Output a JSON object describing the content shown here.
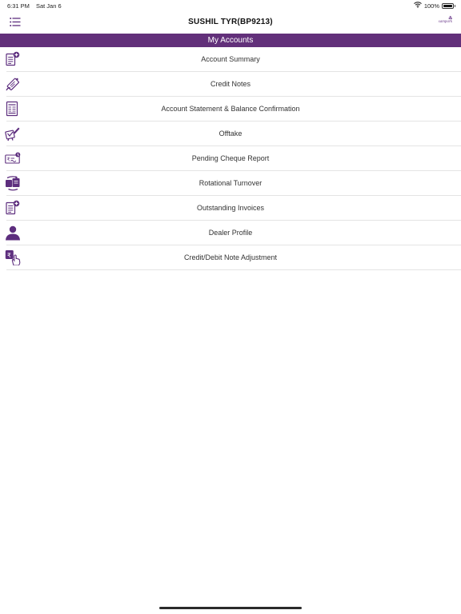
{
  "status_bar": {
    "time": "6:31 PM",
    "date": "Sat Jan 6",
    "battery": "100%"
  },
  "header": {
    "title": "SUSHIL TYR(BP9213)",
    "logo_text": "sampark"
  },
  "section": {
    "title": "My Accounts"
  },
  "menu": {
    "items": [
      {
        "label": "Account Summary",
        "icon": "document-plus-icon"
      },
      {
        "label": "Credit Notes",
        "icon": "credit-note-tag-icon"
      },
      {
        "label": "Account Statement & Balance Confirmation",
        "icon": "statement-ledger-icon"
      },
      {
        "label": "Offtake",
        "icon": "offtake-scanner-icon"
      },
      {
        "label": "Pending Cheque Report",
        "icon": "cheque-icon"
      },
      {
        "label": "Rotational Turnover",
        "icon": "rotational-turnover-icon"
      },
      {
        "label": "Outstanding Invoices",
        "icon": "invoice-plus-icon"
      },
      {
        "label": "Dealer Profile",
        "icon": "person-icon"
      },
      {
        "label": "Credit/Debit Note Adjustment",
        "icon": "rupee-hand-icon"
      }
    ]
  },
  "colors": {
    "brand_purple": "#62307a",
    "icon_purple": "#5d2e7e"
  }
}
